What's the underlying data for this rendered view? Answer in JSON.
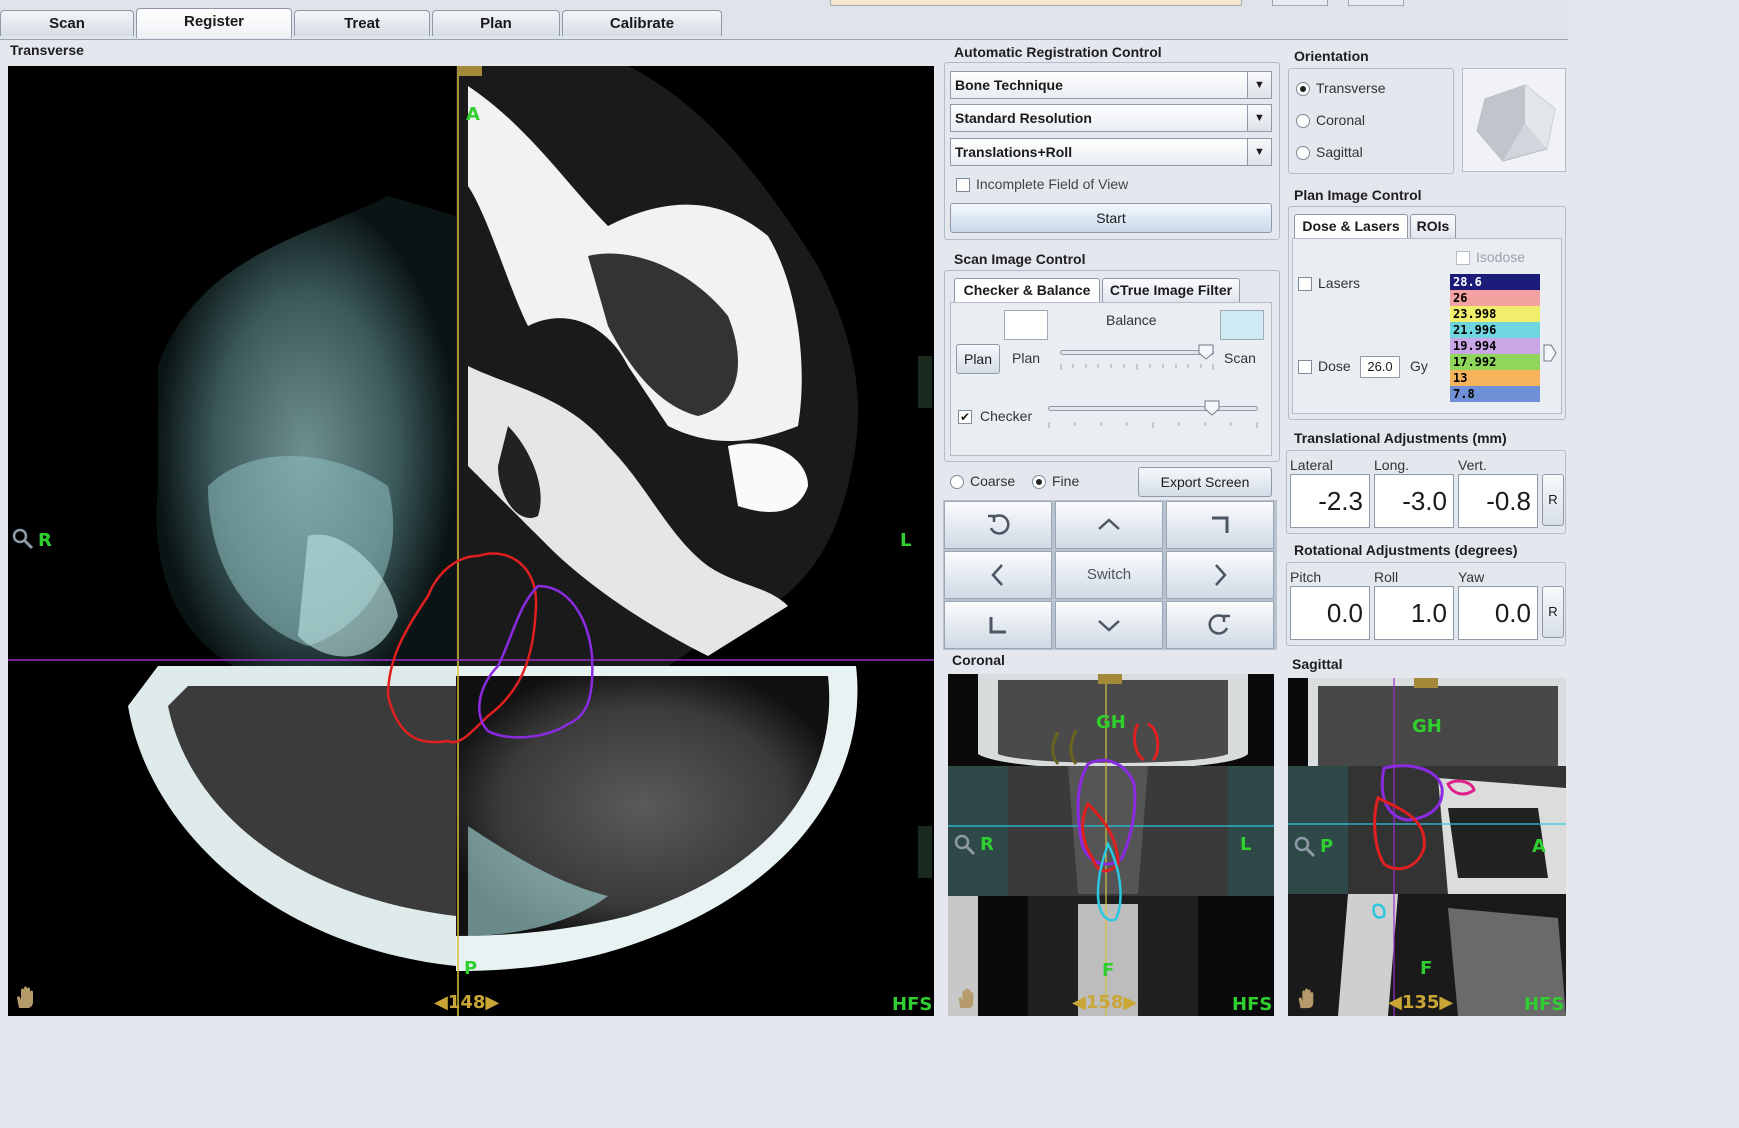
{
  "tabs": [
    {
      "label": "Scan"
    },
    {
      "label": "Register"
    },
    {
      "label": "Treat"
    },
    {
      "label": "Plan"
    },
    {
      "label": "Calibrate"
    }
  ],
  "active_tab": "Register",
  "transverse": {
    "title": "Transverse",
    "labels": {
      "anterior": "A",
      "posterior": "P",
      "right": "R",
      "left": "L"
    },
    "slice": "148",
    "orientation_code": "HFS"
  },
  "coronal": {
    "title": "Coronal",
    "labels": {
      "top": "GH",
      "right": "R",
      "left": "L",
      "bottom": "F"
    },
    "slice": "158",
    "orientation_code": "HFS"
  },
  "sagittal": {
    "title": "Sagittal",
    "labels": {
      "top": "GH",
      "posterior": "P",
      "anterior": "A",
      "bottom": "F"
    },
    "slice": "135",
    "orientation_code": "HFS"
  },
  "auto_registration": {
    "title": "Automatic Registration Control",
    "technique": "Bone Technique",
    "resolution": "Standard Resolution",
    "mode": "Translations+Roll",
    "incomplete_fov_label": "Incomplete Field of View",
    "incomplete_fov_checked": false,
    "start_label": "Start"
  },
  "scan_image_control": {
    "title": "Scan Image Control",
    "tab_checker": "Checker & Balance",
    "tab_filter": "CTrue Image Filter",
    "balance_label": "Balance",
    "plan_button": "Plan",
    "plan_label": "Plan",
    "scan_label": "Scan",
    "checker_label": "Checker",
    "checker_checked": true,
    "balance_level": 0.95,
    "checker_level": 0.78
  },
  "precision": {
    "coarse_label": "Coarse",
    "fine_label": "Fine",
    "selected": "Fine",
    "export_label": "Export Screen"
  },
  "nav": {
    "switch_label": "Switch"
  },
  "orientation": {
    "title": "Orientation",
    "options": [
      "Transverse",
      "Coronal",
      "Sagittal"
    ],
    "selected": "Transverse"
  },
  "plan_image_control": {
    "title": "Plan Image Control",
    "tab_dose": "Dose & Lasers",
    "tab_rois": "ROIs",
    "isodose_label": "Isodose",
    "lasers_label": "Lasers",
    "dose_label": "Dose",
    "dose_value": "26.0",
    "dose_unit": "Gy",
    "isodose_levels": [
      {
        "value": "28.6",
        "color": "#1b1b7a",
        "text_color": "#ffffff"
      },
      {
        "value": "26",
        "color": "#f3a1a1",
        "text_color": "#000000"
      },
      {
        "value": "23.998",
        "color": "#f0ee6a",
        "text_color": "#000000"
      },
      {
        "value": "21.996",
        "color": "#6fd6e0",
        "text_color": "#000000"
      },
      {
        "value": "19.994",
        "color": "#c9a6e6",
        "text_color": "#000000"
      },
      {
        "value": "17.992",
        "color": "#8fd65a",
        "text_color": "#000000"
      },
      {
        "value": "13",
        "color": "#f6b35c",
        "text_color": "#000000"
      },
      {
        "value": "7.8",
        "color": "#6f8fd6",
        "text_color": "#000000"
      }
    ]
  },
  "translational": {
    "title": "Translational Adjustments (mm)",
    "labels": [
      "Lateral",
      "Long.",
      "Vert."
    ],
    "values": [
      "-2.3",
      "-3.0",
      "-0.8"
    ],
    "reset_label": "R"
  },
  "rotational": {
    "title": "Rotational Adjustments (degrees)",
    "labels": [
      "Pitch",
      "Roll",
      "Yaw"
    ],
    "values": [
      "0.0",
      "1.0",
      "0.0"
    ],
    "reset_label": "R"
  },
  "colors": {
    "contour_red": "#e02020",
    "contour_purple": "#8a2be2",
    "contour_cyan": "#29c8e0",
    "crosshair_yellow": "#d6c040",
    "crosshair_purple": "#9b30c8",
    "label_green": "#2fcf2f"
  }
}
